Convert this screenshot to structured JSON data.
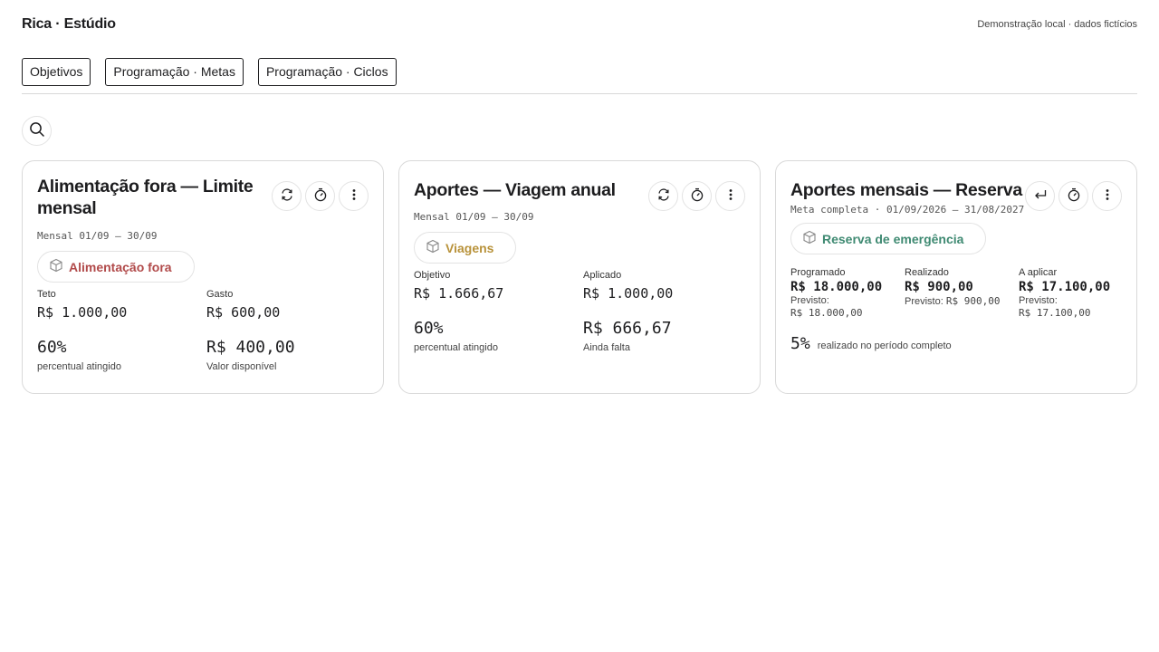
{
  "app": {
    "brand": "Rica · Estúdio",
    "demo_note": "Demonstração local · dados fictícios"
  },
  "tabs": [
    {
      "label": "Objetivos"
    },
    {
      "label": "Programação · Metas"
    },
    {
      "label": "Programação · Ciclos"
    }
  ],
  "cards": [
    {
      "title": "Alimentação fora — Limite mensal",
      "period": "Mensal 01/09 – 30/09",
      "category": "Alimentação fora",
      "category_color": "#b14a4a",
      "left_label": "Teto",
      "left_value": "R$ 1.000,00",
      "right_label": "Gasto",
      "right_value": "R$ 600,00",
      "percent": "60%",
      "percent_label": "percentual atingido",
      "remaining": "R$ 400,00",
      "remaining_label": "Valor disponível",
      "actions": [
        "refresh-icon",
        "timer-icon",
        "more-vertical-icon"
      ]
    },
    {
      "title": "Aportes — Viagem anual",
      "period": "Mensal 01/09 – 30/09",
      "category": "Viagens",
      "category_color": "#b8923a",
      "left_label": "Objetivo",
      "left_value": "R$ 1.666,67",
      "right_label": "Aplicado",
      "right_value": "R$ 1.000,00",
      "percent": "60%",
      "percent_label": "percentual atingido",
      "remaining": "R$ 666,67",
      "remaining_label": "Ainda falta",
      "actions": [
        "refresh-icon",
        "timer-icon",
        "more-vertical-icon"
      ]
    },
    {
      "title": "Aportes mensais — Reserva",
      "period": "Meta completa · 01/09/2026 – 31/08/2027",
      "category": "Reserva de emergência",
      "category_color": "#3f8a72",
      "columns": [
        {
          "label": "Programado",
          "value": "R$ 18.000,00",
          "prev_label": "Previsto:",
          "prev_value": "R$ 18.000,00"
        },
        {
          "label": "Realizado",
          "value": "R$ 900,00",
          "prev_label": "Previsto:",
          "prev_value": "R$ 900,00"
        },
        {
          "label": "A aplicar",
          "value": "R$ 17.100,00",
          "prev_label": "Previsto:",
          "prev_value": "R$ 17.100,00"
        }
      ],
      "percent": "5%",
      "percent_label": "realizado no período completo",
      "actions": [
        "return-icon",
        "timer-icon",
        "more-vertical-icon"
      ]
    }
  ]
}
